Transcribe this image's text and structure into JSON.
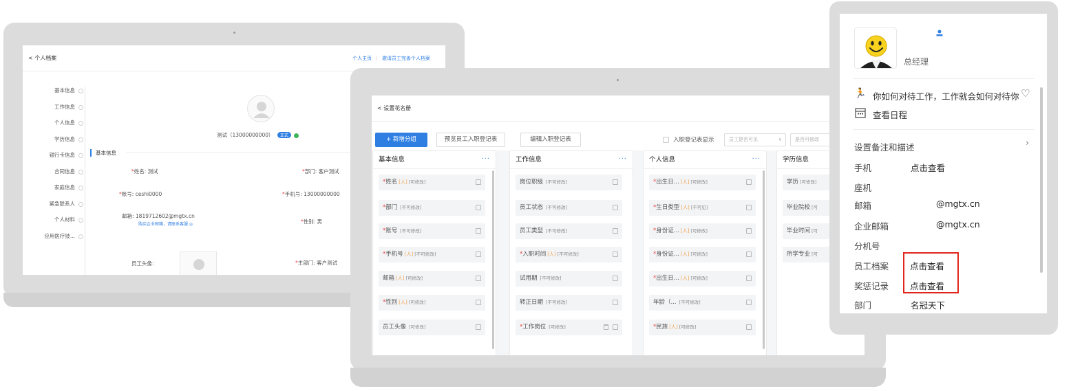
{
  "personal_file": {
    "back_label": "< 个人档案",
    "link_home": "个人主页",
    "link_invite": "邀请员工完善个人档案",
    "nav": [
      "基本信息",
      "工作信息",
      "个人信息",
      "学历信息",
      "银行卡信息",
      "合同信息",
      "家庭信息",
      "紧急联系人",
      "个人材料",
      "应用医疗技..."
    ],
    "name_line": "测试（13000000000）",
    "status_badge": "正式",
    "section_title": "基本信息",
    "fields": {
      "name": {
        "req": "*",
        "label": "姓名: 测试"
      },
      "dept": {
        "req": "*",
        "label": "部门: 客户测试"
      },
      "account": {
        "req": "*",
        "label": "账号: ceshi0000"
      },
      "mobile": {
        "req": "*",
        "label": "手机号: 13000000000"
      },
      "email": {
        "label": "邮箱: 1819712602@mgtx.cn"
      },
      "email_hint": "购买企业邮箱，请联系客服 ◎",
      "gender": {
        "req": "*",
        "label": "性别: 男"
      },
      "photo": {
        "label": "员工头像:"
      },
      "main_dept": {
        "req": "*",
        "label": "主部门: 客户测试"
      }
    }
  },
  "roster": {
    "back_label": "< 设置花名册",
    "add_group": "+ 新增分组",
    "preview_entry": "预览员工入职登记表",
    "edit_entry": "编辑入职登记表",
    "entry_display": "入职登记表显示",
    "select1": "员工是否可见",
    "select2": "是否可修改",
    "more": "···",
    "columns": [
      {
        "title": "基本信息",
        "items": [
          {
            "req": "*",
            "name": "姓名",
            "a": "[人]",
            "t": "[可修改]"
          },
          {
            "req": "*",
            "name": "部门",
            "a": "",
            "t": "[不可修改]"
          },
          {
            "req": "*",
            "name": "账号",
            "a": "",
            "t": "[不可修改]"
          },
          {
            "req": "*",
            "name": "手机号",
            "a": "[人]",
            "t": "[不可修改]"
          },
          {
            "req": "",
            "name": "邮箱",
            "a": "[人]",
            "t": "[可修改]"
          },
          {
            "req": "*",
            "name": "性别",
            "a": "[人]",
            "t": "[可修改]"
          },
          {
            "req": "",
            "name": "员工头像",
            "a": "",
            "t": "[可修改]"
          }
        ]
      },
      {
        "title": "工作信息",
        "items": [
          {
            "req": "",
            "name": "岗位职级",
            "a": "",
            "t": "[不可修改]"
          },
          {
            "req": "",
            "name": "员工状态",
            "a": "",
            "t": "[不可修改]"
          },
          {
            "req": "",
            "name": "员工类型",
            "a": "",
            "t": "[不可修改]"
          },
          {
            "req": "*",
            "name": "入职时间",
            "a": "[人]",
            "t": "[不可修改]"
          },
          {
            "req": "",
            "name": "试用期",
            "a": "",
            "t": "[不可修改]"
          },
          {
            "req": "",
            "name": "转正日期",
            "a": "",
            "t": "[不可修改]"
          },
          {
            "req": "*",
            "name": "工作岗位",
            "a": "",
            "t": "[可修改]"
          }
        ]
      },
      {
        "title": "个人信息",
        "items": [
          {
            "req": "*",
            "name": "出生日...",
            "a": "[人]",
            "t": "[可修改]"
          },
          {
            "req": "*",
            "name": "生日类型",
            "a": "[人]",
            "t": "[不可见]"
          },
          {
            "req": "*",
            "name": "身份证...",
            "a": "[人]",
            "t": "[可修改]"
          },
          {
            "req": "*",
            "name": "身份证...",
            "a": "[人]",
            "t": "[可修改]"
          },
          {
            "req": "*",
            "name": "出生日...",
            "a": "[人]",
            "t": "[可修改]"
          },
          {
            "req": "",
            "name": "年龄（...",
            "a": "",
            "t": "[不可修改]"
          },
          {
            "req": "*",
            "name": "民族",
            "a": "[人]",
            "t": "[可修改]"
          }
        ]
      },
      {
        "title": "学历信息",
        "items": [
          {
            "req": "",
            "name": "学历",
            "a": "",
            "t": "[可修改]"
          },
          {
            "req": "",
            "name": "毕业院校",
            "a": "",
            "t": "[可"
          },
          {
            "req": "",
            "name": "毕业时间",
            "a": "",
            "t": "[可"
          },
          {
            "req": "",
            "name": "所学专业",
            "a": "",
            "t": "[可"
          }
        ]
      }
    ]
  },
  "mobile_profile": {
    "title": "总经理",
    "motto": "你如何对待工作，工作就会如何对待你",
    "schedule": "查看日程",
    "remarks": "设置备注和描述",
    "rows": [
      {
        "label": "手机",
        "value": "点击查看"
      },
      {
        "label": "座机",
        "value": ""
      },
      {
        "label": "邮箱",
        "value": "@mgtx.cn"
      },
      {
        "label": "企业邮箱",
        "value": "@mgtx.cn"
      },
      {
        "label": "分机号",
        "value": ""
      },
      {
        "label": "员工档案",
        "value": "点击查看"
      },
      {
        "label": "奖惩记录",
        "value": "点击查看"
      },
      {
        "label": "部门",
        "value": "名冠天下"
      }
    ]
  },
  "colors": {
    "accent": "#2f7fe3",
    "required": "#e64340",
    "highlight": "#e0251b",
    "tag": "#f0a04a"
  }
}
